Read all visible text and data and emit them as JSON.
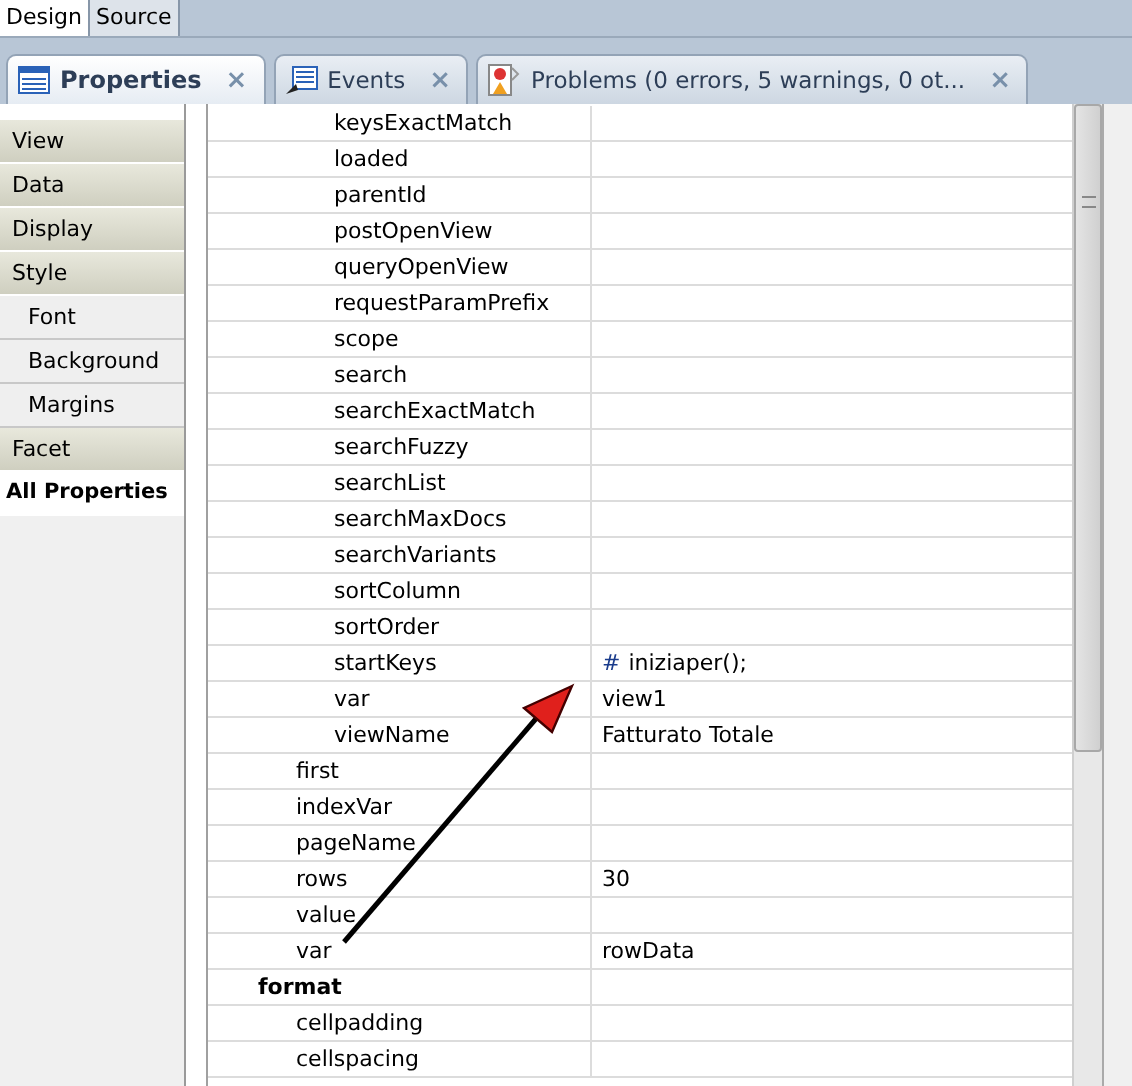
{
  "editor_tabs": [
    {
      "label": "Design",
      "selected": true
    },
    {
      "label": "Source",
      "selected": false
    }
  ],
  "view_tabs": [
    {
      "label": "Properties",
      "selected": true,
      "close": "×"
    },
    {
      "label": "Events",
      "selected": false,
      "close": "×"
    },
    {
      "label": "Problems (0 errors, 5 warnings, 0 ot...",
      "selected": false,
      "close": "×"
    }
  ],
  "sidebar": {
    "items": [
      {
        "label": "View",
        "kind": "category",
        "selected": false
      },
      {
        "label": "Data",
        "kind": "category",
        "selected": false
      },
      {
        "label": "Display",
        "kind": "category",
        "selected": false
      },
      {
        "label": "Style",
        "kind": "category",
        "selected": false
      },
      {
        "label": "Font",
        "kind": "subcategory",
        "selected": false
      },
      {
        "label": "Background",
        "kind": "subcategory",
        "selected": false
      },
      {
        "label": "Margins",
        "kind": "subcategory",
        "selected": false
      },
      {
        "label": "Facet",
        "kind": "category",
        "selected": false
      },
      {
        "label": "All Properties",
        "kind": "category",
        "selected": true
      }
    ]
  },
  "properties": [
    {
      "children": [
        {
          "children": [
            {
              "name": "keysExactMatch"
            },
            {
              "name": "loaded"
            },
            {
              "name": "parentId"
            },
            {
              "name": "postOpenView"
            },
            {
              "name": "queryOpenView"
            },
            {
              "name": "requestParamPrefix"
            },
            {
              "name": "scope"
            },
            {
              "name": "search"
            },
            {
              "name": "searchExactMatch"
            },
            {
              "name": "searchFuzzy"
            },
            {
              "name": "searchList"
            },
            {
              "name": "searchMaxDocs"
            },
            {
              "name": "searchVariants"
            },
            {
              "name": "sortColumn"
            },
            {
              "name": "sortOrder"
            },
            {
              "name": "startKeys",
              "marker": "#",
              "value": "iniziaper();"
            },
            {
              "name": "var",
              "value": "view1"
            },
            {
              "name": "viewName",
              "value": "Fatturato Totale"
            }
          ]
        },
        {
          "name": "first"
        },
        {
          "name": "indexVar"
        },
        {
          "name": "pageName"
        },
        {
          "name": "rows",
          "value": "30"
        },
        {
          "name": "value"
        },
        {
          "name": "var",
          "value": "rowData"
        }
      ]
    },
    {
      "name": "format",
      "children": [
        {
          "name": "cellpadding"
        },
        {
          "name": "cellspacing"
        }
      ]
    }
  ]
}
